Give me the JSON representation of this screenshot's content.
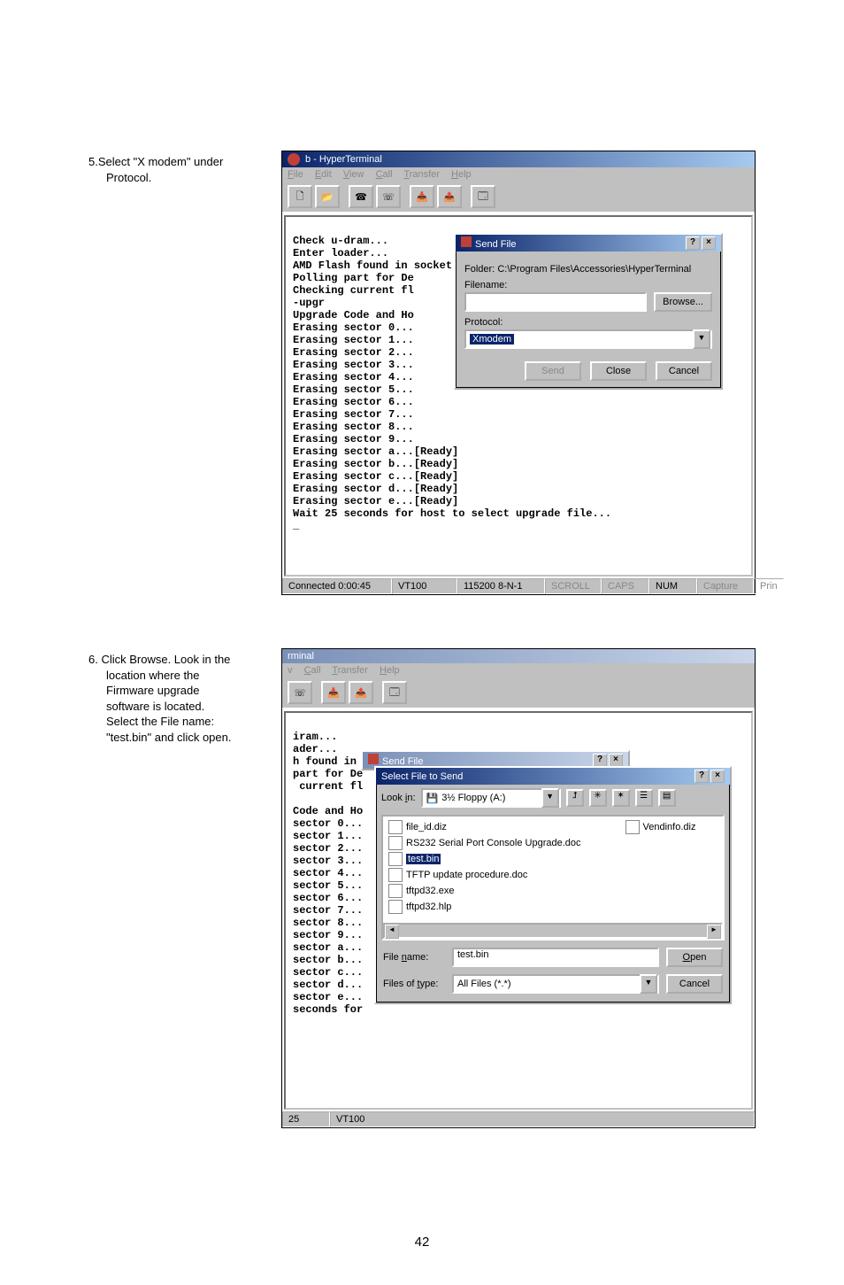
{
  "steps": {
    "s5": {
      "head": "5.Select \"X modem\" under",
      "body": "Protocol."
    },
    "s6": {
      "head": "6.  Click Browse.  Look in the",
      "lines": [
        "location where the",
        "Firmware upgrade",
        "software is located.",
        "Select the File name:",
        "\"test.bin\" and click open."
      ]
    }
  },
  "shot1": {
    "title": "b - HyperTerminal",
    "menu": [
      "File",
      "Edit",
      "View",
      "Call",
      "Transfer",
      "Help"
    ],
    "term": "Check u-dram...\nEnter loader...\nAMD Flash found in socket\nPolling part for De\nChecking current fl\n-upgr\nUpgrade Code and Ho\nErasing sector 0...\nErasing sector 1...\nErasing sector 2...\nErasing sector 3...\nErasing sector 4...\nErasing sector 5...\nErasing sector 6...\nErasing sector 7...\nErasing sector 8...\nErasing sector 9...\nErasing sector a...[Ready]\nErasing sector b...[Ready]\nErasing sector c...[Ready]\nErasing sector d...[Ready]\nErasing sector e...[Ready]\nWait 25 seconds for host to select upgrade file...\n_",
    "status": [
      "Connected 0:00:45",
      "VT100",
      "115200 8-N-1",
      "SCROLL",
      "CAPS",
      "NUM",
      "Capture",
      "Prin"
    ],
    "dlg": {
      "title": "Send File",
      "folder_lbl": "Folder:",
      "folder": "C:\\Program Files\\Accessories\\HyperTerminal",
      "filename_lbl": "Filename:",
      "browse": "Browse...",
      "protocol_lbl": "Protocol:",
      "protocol": "Xmodem",
      "send": "Send",
      "close": "Close",
      "cancel": "Cancel"
    }
  },
  "shot2": {
    "title": "rminal",
    "menu": [
      "v",
      "Call",
      "Transfer",
      "Help"
    ],
    "term": "iram...\nader...\nh found in socket\npart for De\n current fl\n\nCode and Ho\nsector 0...\nsector 1...\nsector 2...\nsector 3...\nsector 4...\nsector 5...\nsector 6...\nsector 7...\nsector 8...\nsector 9...\nsector a...\nsector b...\nsector c...\nsector d...\nsector e...\nseconds for",
    "status": [
      "25",
      "VT100"
    ],
    "dlg": {
      "title": "Send File",
      "sub_title": "Select File to Send",
      "lookin_lbl": "Look in:",
      "lookin": "3½ Floppy (A:)",
      "files_left": [
        "file_id.diz",
        "RS232 Serial Port Console Upgrade.doc",
        "test.bin",
        "TFTP update procedure.doc",
        "tftpd32.exe",
        "tftpd32.hlp"
      ],
      "files_right": [
        "Vendinfo.diz"
      ],
      "filename_lbl": "File name:",
      "filename": "test.bin",
      "filetype_lbl": "Files of type:",
      "filetype": "All Files (*.*)",
      "open": "Open",
      "cancel": "Cancel"
    }
  },
  "pagenum": "42"
}
